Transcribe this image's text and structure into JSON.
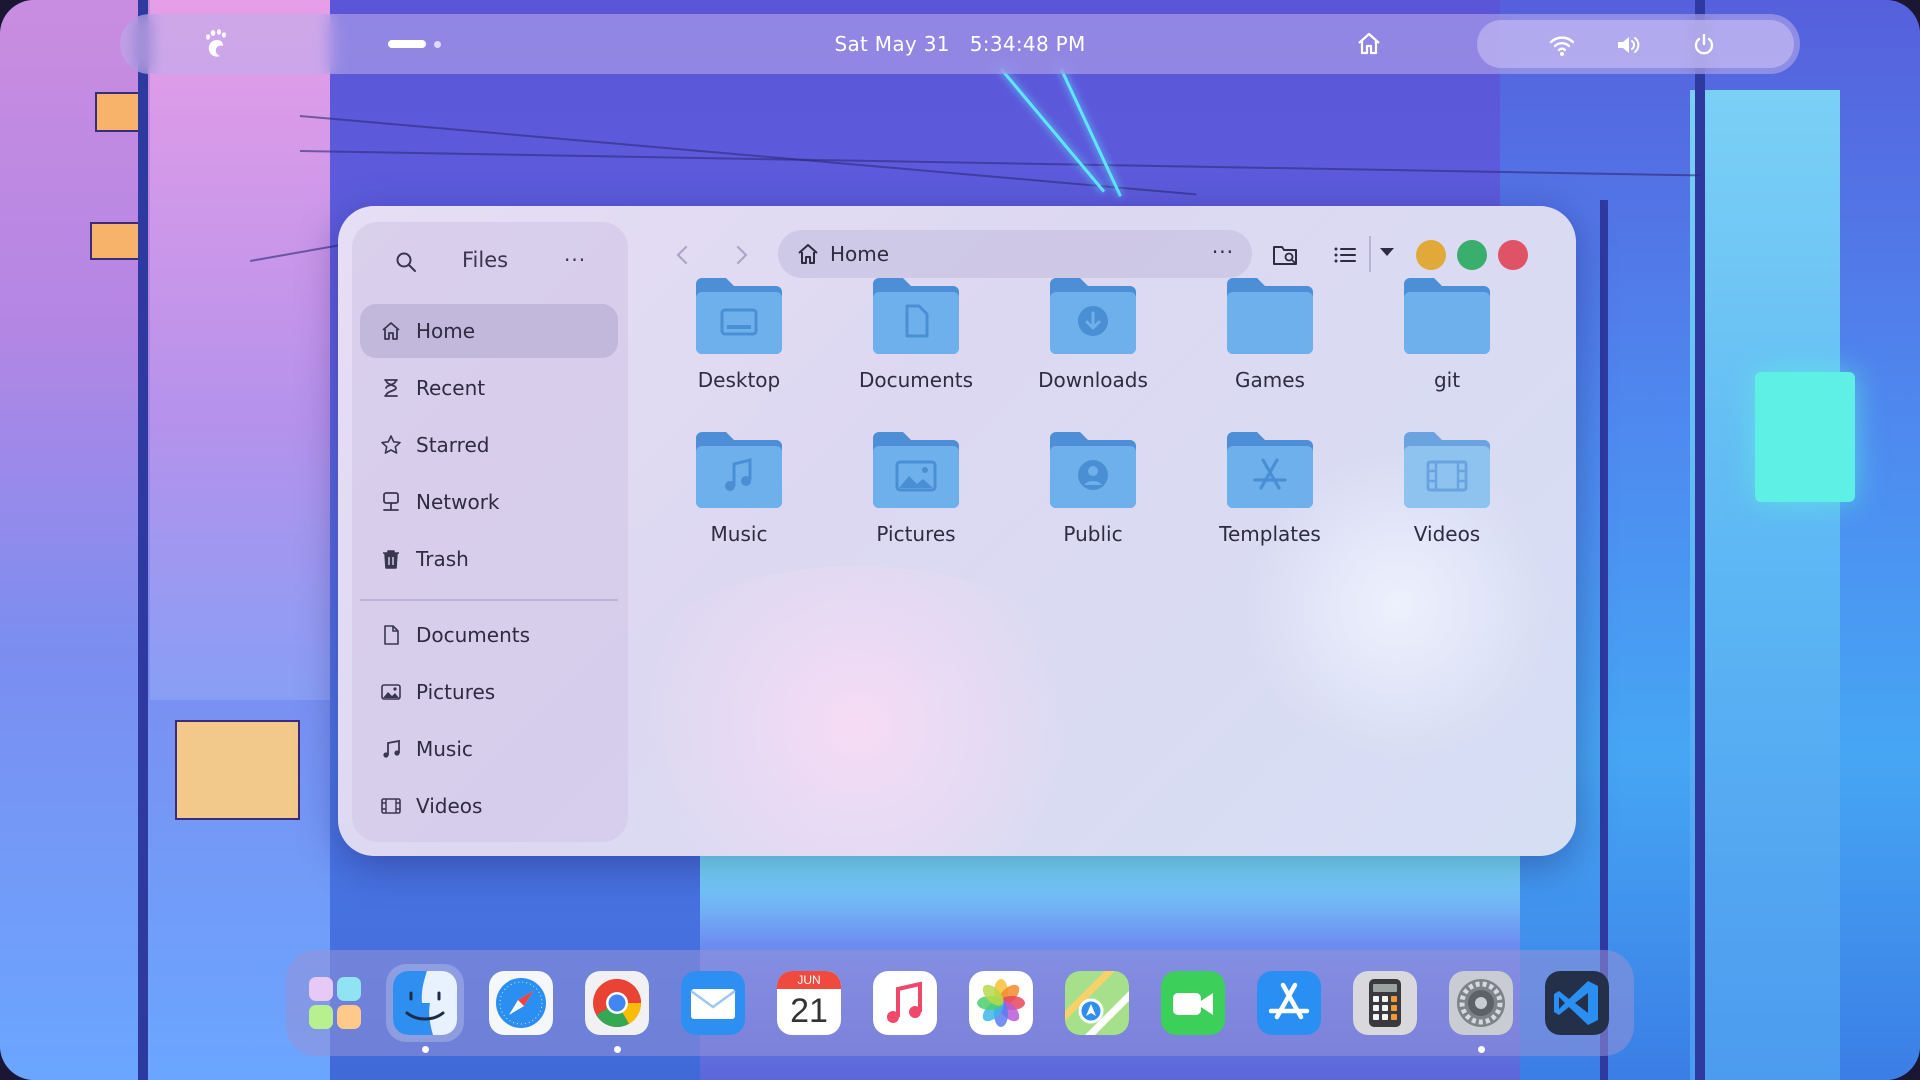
{
  "topbar": {
    "date": "Sat May 31",
    "time": "5:34:48 PM",
    "icons": [
      "gnome-foot-icon",
      "home-icon",
      "wifi-icon",
      "volume-icon",
      "power-icon"
    ]
  },
  "files": {
    "sidebar": {
      "title": "Files",
      "more": "···",
      "places": [
        {
          "label": "Home",
          "icon": "home-icon",
          "active": true
        },
        {
          "label": "Recent",
          "icon": "recent-icon"
        },
        {
          "label": "Starred",
          "icon": "star-icon"
        },
        {
          "label": "Network",
          "icon": "network-icon"
        },
        {
          "label": "Trash",
          "icon": "trash-icon"
        }
      ],
      "bookmarks": [
        {
          "label": "Documents",
          "icon": "document-icon"
        },
        {
          "label": "Pictures",
          "icon": "picture-icon"
        },
        {
          "label": "Music",
          "icon": "music-icon"
        },
        {
          "label": "Videos",
          "icon": "video-icon"
        }
      ]
    },
    "pathbar": {
      "label": "Home",
      "more": "···"
    },
    "folders": [
      {
        "label": "Desktop",
        "icon": "desktop-folder-icon"
      },
      {
        "label": "Documents",
        "icon": "documents-folder-icon"
      },
      {
        "label": "Downloads",
        "icon": "downloads-folder-icon"
      },
      {
        "label": "Games",
        "icon": "folder-icon"
      },
      {
        "label": "git",
        "icon": "folder-icon"
      },
      {
        "label": "Music",
        "icon": "music-folder-icon"
      },
      {
        "label": "Pictures",
        "icon": "pictures-folder-icon"
      },
      {
        "label": "Public",
        "icon": "public-folder-icon"
      },
      {
        "label": "Templates",
        "icon": "templates-folder-icon"
      },
      {
        "label": "Videos",
        "icon": "videos-folder-icon"
      }
    ],
    "window_controls": {
      "minimize": "#e0a93a",
      "maximize": "#3aae6d",
      "close": "#e05266"
    }
  },
  "dock": {
    "calendar_month": "JUN",
    "calendar_day": "21",
    "apps": [
      {
        "name": "launcher",
        "running": false
      },
      {
        "name": "finder",
        "running": true
      },
      {
        "name": "safari",
        "running": false
      },
      {
        "name": "chrome",
        "running": true
      },
      {
        "name": "mail",
        "running": false
      },
      {
        "name": "calendar",
        "running": false
      },
      {
        "name": "music",
        "running": false
      },
      {
        "name": "photos",
        "running": false
      },
      {
        "name": "maps",
        "running": false
      },
      {
        "name": "facetime",
        "running": false
      },
      {
        "name": "app-store",
        "running": false
      },
      {
        "name": "calculator",
        "running": false
      },
      {
        "name": "system-settings",
        "running": true
      },
      {
        "name": "vscode",
        "running": false
      }
    ]
  }
}
